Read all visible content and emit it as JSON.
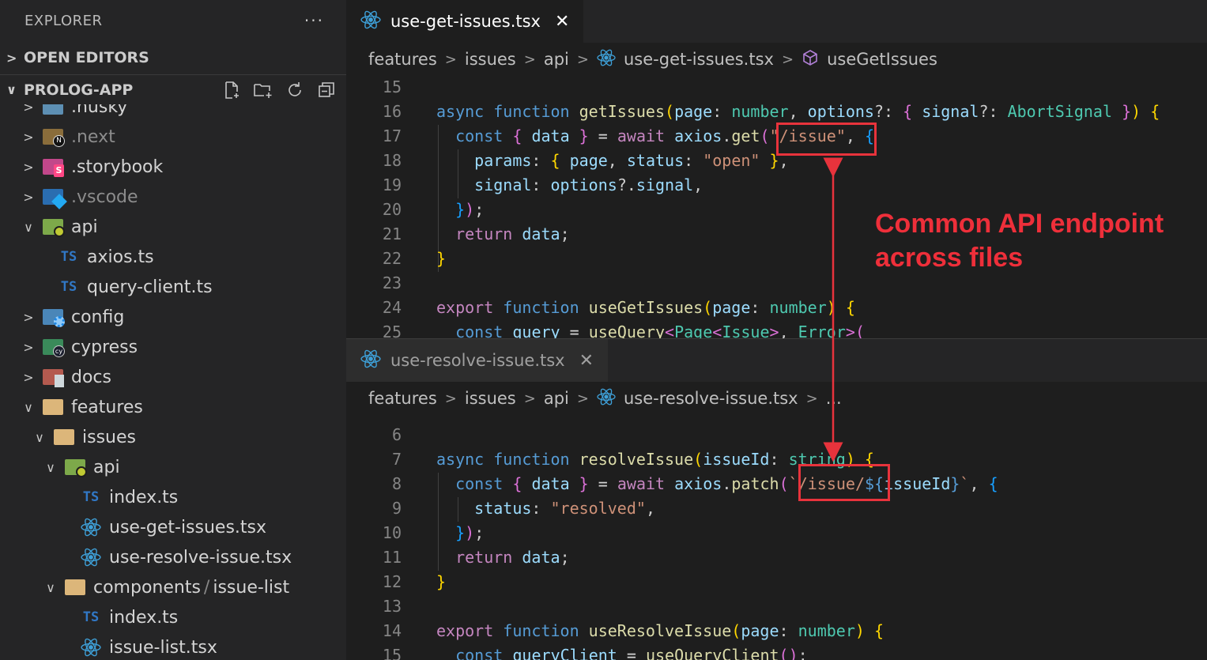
{
  "sidebar": {
    "title": "EXPLORER",
    "more": "···",
    "open_editors": "OPEN EDITORS",
    "project": "PROLOG-APP",
    "tree": [
      {
        "label": ".husky",
        "chev": ">",
        "icon": "husky-folder-icon",
        "dim": false
      },
      {
        "label": ".next",
        "chev": ">",
        "icon": "next-folder-icon",
        "dim": true
      },
      {
        "label": ".storybook",
        "chev": ">",
        "icon": "storybook-folder-icon",
        "dim": false
      },
      {
        "label": ".vscode",
        "chev": ">",
        "icon": "vscode-folder-icon",
        "dim": true
      },
      {
        "label": "api",
        "chev": "∨",
        "icon": "api-folder-icon",
        "dim": false
      },
      {
        "label": "axios.ts",
        "chev": "",
        "icon": "ts-file-icon",
        "dim": false
      },
      {
        "label": "query-client.ts",
        "chev": "",
        "icon": "ts-file-icon",
        "dim": false
      },
      {
        "label": "config",
        "chev": ">",
        "icon": "config-folder-icon",
        "dim": false
      },
      {
        "label": "cypress",
        "chev": ">",
        "icon": "cypress-folder-icon",
        "dim": false
      },
      {
        "label": "docs",
        "chev": ">",
        "icon": "docs-folder-icon",
        "dim": false
      },
      {
        "label": "features",
        "chev": "∨",
        "icon": "folder-open-icon",
        "dim": false
      },
      {
        "label": "issues",
        "chev": "∨",
        "icon": "folder-open-icon",
        "dim": false
      },
      {
        "label": "api",
        "chev": "∨",
        "icon": "api-folder-icon",
        "dim": false
      },
      {
        "label": "index.ts",
        "chev": "",
        "icon": "ts-file-icon",
        "dim": false
      },
      {
        "label": "use-get-issues.tsx",
        "chev": "",
        "icon": "react-icon",
        "dim": false
      },
      {
        "label": "use-resolve-issue.tsx",
        "chev": "",
        "icon": "react-icon",
        "dim": false
      },
      {
        "label": "components",
        "label2": "issue-list",
        "chev": "∨",
        "icon": "folder-open-icon",
        "dim": false
      },
      {
        "label": "index.ts",
        "chev": "",
        "icon": "ts-file-icon",
        "dim": false
      },
      {
        "label": "issue-list.tsx",
        "chev": "",
        "icon": "react-icon",
        "dim": false
      }
    ],
    "ts_badge": "TS",
    "path_sep": "/"
  },
  "top_editor": {
    "tab": "use-get-issues.tsx",
    "close": "✕",
    "breadcrumb": [
      "features",
      "issues",
      "api",
      "use-get-issues.tsx",
      "useGetIssues"
    ],
    "line_numbers": [
      "15",
      "16",
      "17",
      "18",
      "19",
      "20",
      "21",
      "22",
      "23",
      "24",
      "25"
    ]
  },
  "bottom_editor": {
    "tab": "use-resolve-issue.tsx",
    "close": "✕",
    "breadcrumb": [
      "features",
      "issues",
      "api",
      "use-resolve-issue.tsx",
      "..."
    ],
    "line_numbers": [
      "6",
      "7",
      "8",
      "9",
      "10",
      "11",
      "12",
      "13",
      "14",
      "15"
    ]
  },
  "annotation": {
    "line1": "Common API endpoint",
    "line2": "across files",
    "color": "#ee2f3a"
  },
  "colors": {
    "keyword": "#569cd6",
    "control": "#c586c0",
    "function": "#dcdcaa",
    "variable": "#9cdcfe",
    "type": "#4ec9b0",
    "string": "#ce9178"
  }
}
